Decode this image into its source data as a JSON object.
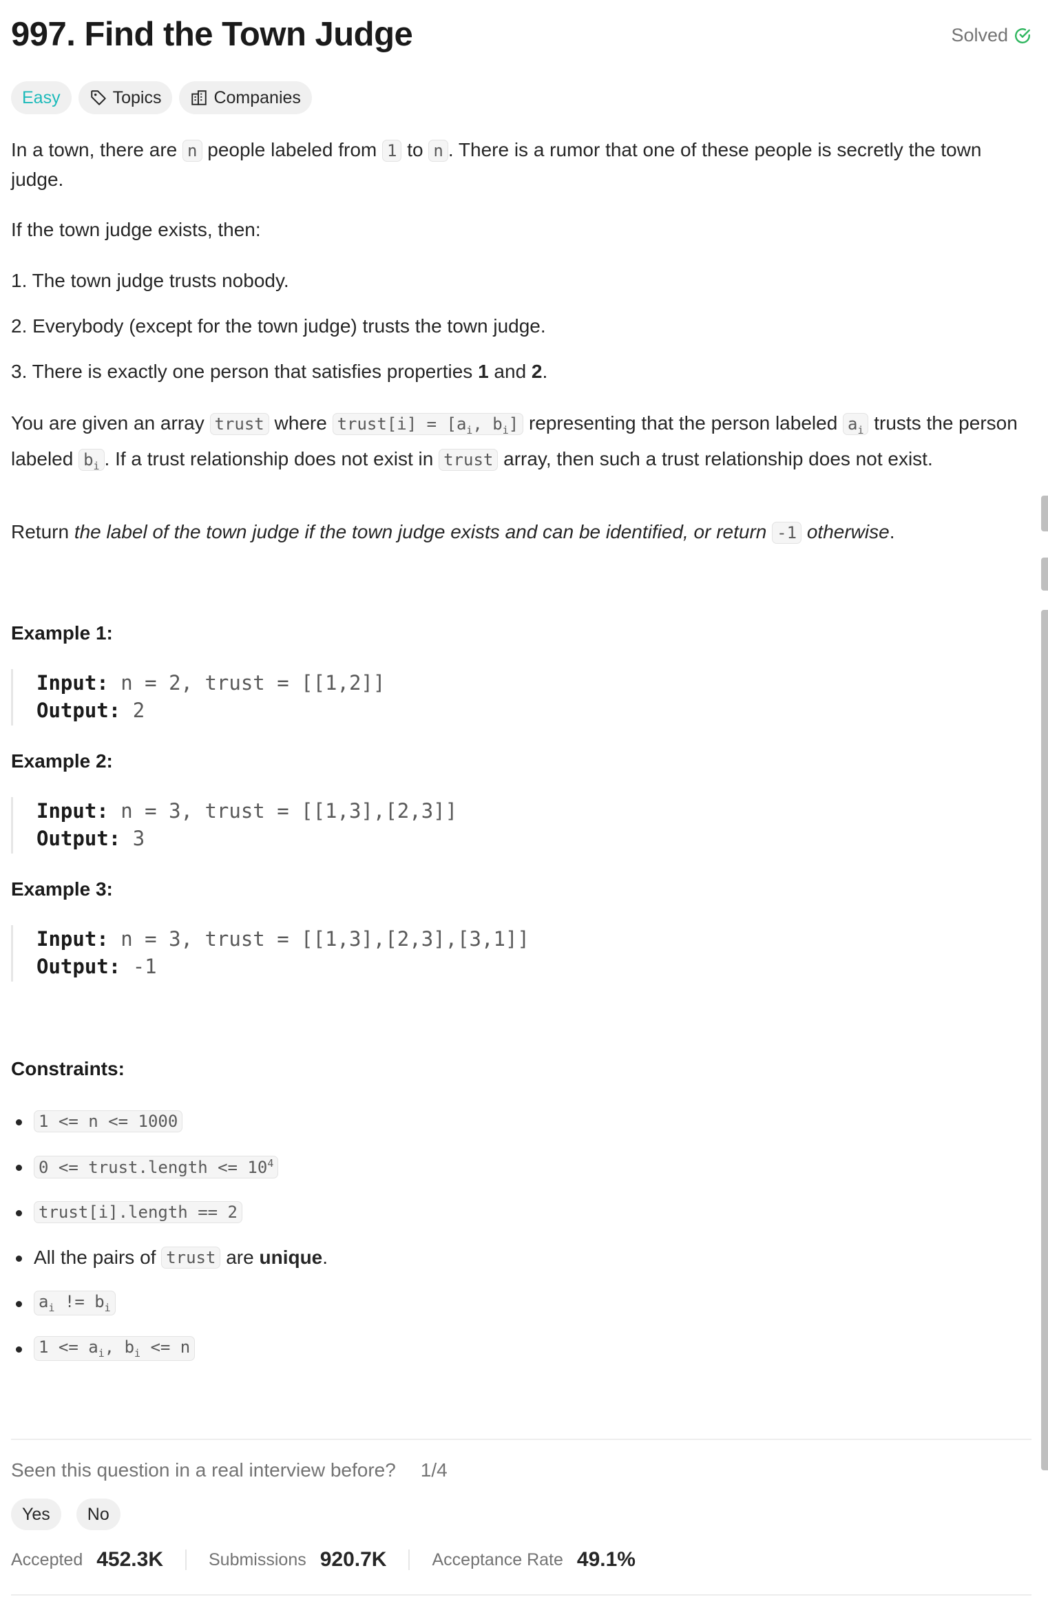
{
  "problem": {
    "title": "997. Find the Town Judge",
    "status": "Solved",
    "difficulty": "Easy",
    "tags": [
      "Topics",
      "Companies"
    ]
  },
  "description": {
    "p1_a": "In a town, there are ",
    "p1_code_n": "n",
    "p1_b": " people labeled from ",
    "p1_code_1": "1",
    "p1_c": " to ",
    "p1_code_n2": "n",
    "p1_d": ". There is a rumor that one of these people is secretly the town judge.",
    "p2": "If the town judge exists, then:",
    "rule1": "1. The town judge trusts nobody.",
    "rule2": "2. Everybody (except for the town judge) trusts the town judge.",
    "rule3_a": "3. There is exactly one person that satisfies properties ",
    "rule3_b1": "1",
    "rule3_and": " and ",
    "rule3_b2": "2",
    "rule3_end": ".",
    "p4_a": "You are given an array ",
    "p4_code_trust": "trust",
    "p4_b": " where ",
    "p4_c": " representing that the person labeled ",
    "p4_d": " trusts the person labeled ",
    "p4_e": ". If a trust relationship does not exist in ",
    "p4_f": " array, then such a trust relationship does not exist.",
    "p5_a": "Return ",
    "p5_italic": "the label of the town judge if the town judge exists and can be identified, or return ",
    "p5_code": "-1",
    "p5_italic_end": " otherwise",
    "p5_end": "."
  },
  "examples": [
    {
      "title": "Example 1:",
      "input_label": "Input:",
      "input": "n = 2, trust = [[1,2]]",
      "output_label": "Output:",
      "output": "2"
    },
    {
      "title": "Example 2:",
      "input_label": "Input:",
      "input": "n = 3, trust = [[1,3],[2,3]]",
      "output_label": "Output:",
      "output": "3"
    },
    {
      "title": "Example 3:",
      "input_label": "Input:",
      "input": "n = 3, trust = [[1,3],[2,3],[3,1]]",
      "output_label": "Output:",
      "output": "-1"
    }
  ],
  "constraints": {
    "title": "Constraints:",
    "c1": "1 <= n <= 1000",
    "c2": "0 <= trust.length <= 10",
    "c2_sup": "4",
    "c3": "trust[i].length == 2",
    "c4_a": "All the pairs of ",
    "c4_code": "trust",
    "c4_b": " are ",
    "c4_bold": "unique",
    "c4_end": "."
  },
  "interview": {
    "question": "Seen this question in a real interview before?",
    "counter": "1/4",
    "yes": "Yes",
    "no": "No"
  },
  "stats": {
    "accepted_label": "Accepted",
    "accepted_value": "452.3K",
    "submissions_label": "Submissions",
    "submissions_value": "920.7K",
    "rate_label": "Acceptance Rate",
    "rate_value": "49.1%"
  },
  "colors": {
    "easy": "#1cbaba",
    "solved_check": "#2db55d"
  },
  "icons": [
    "check-circle-icon",
    "tag-icon",
    "building-icon"
  ]
}
